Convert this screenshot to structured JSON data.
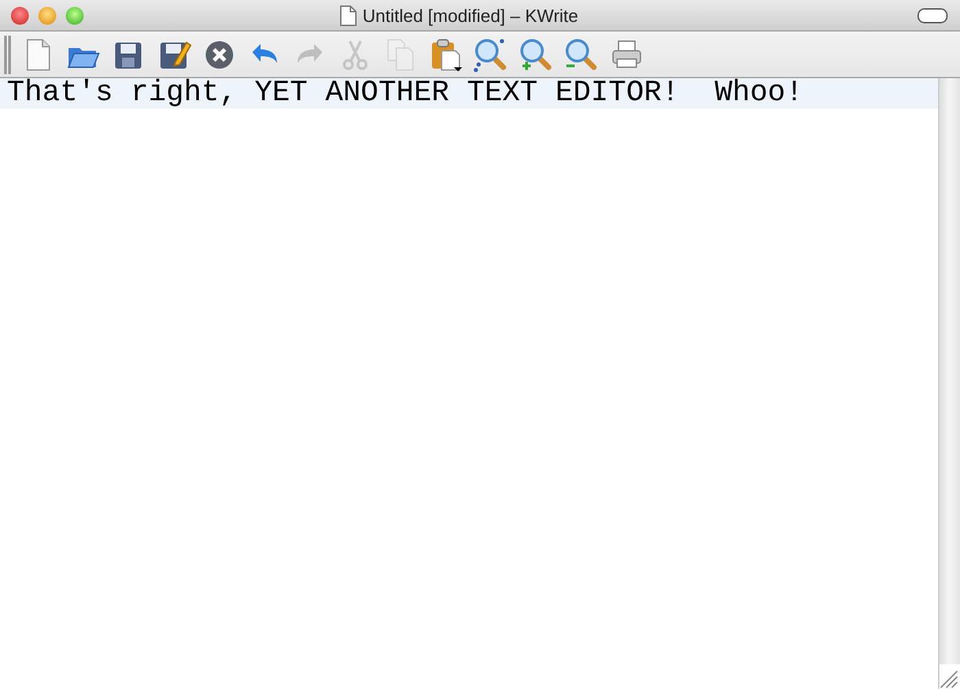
{
  "window": {
    "title": "Untitled [modified] – KWrite"
  },
  "toolbar": [
    {
      "kind": "new",
      "disabled": false
    },
    {
      "kind": "open",
      "disabled": false
    },
    {
      "kind": "save",
      "disabled": false
    },
    {
      "kind": "saveas",
      "disabled": false
    },
    {
      "kind": "close",
      "disabled": false
    },
    {
      "kind": "undo",
      "disabled": false
    },
    {
      "kind": "redo",
      "disabled": true
    },
    {
      "kind": "cut",
      "disabled": true
    },
    {
      "kind": "copy",
      "disabled": true
    },
    {
      "kind": "paste",
      "disabled": false
    },
    {
      "kind": "find",
      "disabled": false
    },
    {
      "kind": "zoomin",
      "disabled": false
    },
    {
      "kind": "zoomout",
      "disabled": false
    },
    {
      "kind": "print",
      "disabled": false
    }
  ],
  "editor": {
    "lines": [
      {
        "text": "That's right, YET ANOTHER TEXT EDITOR!  Whoo!",
        "current": true
      }
    ]
  }
}
